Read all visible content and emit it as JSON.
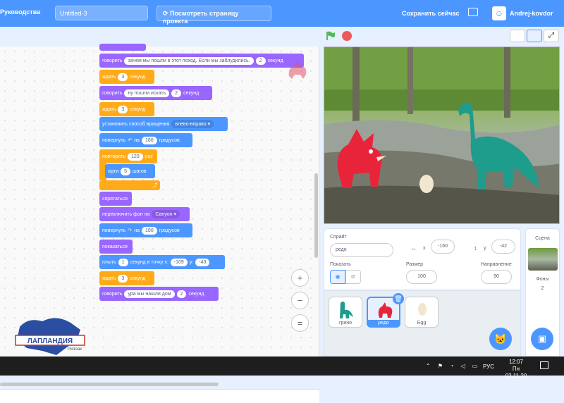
{
  "menubar": {
    "tutorials": "Руководства",
    "project_title": "Untitled-3",
    "see_project_page": "Посмотреть страницу проекта",
    "save_now": "Сохранить сейчас",
    "username": "Andrej-kovdor"
  },
  "script": {
    "b1": {
      "text": "говорить",
      "arg": "зачем мы пошли в этот поход. Если мы заблудились.",
      "num": "2",
      "tail": "секунд"
    },
    "b2": {
      "text": "ждать",
      "num": "3",
      "tail": "секунд"
    },
    "b3": {
      "text": "говорить",
      "arg": "ну пошли искать",
      "num": "2",
      "tail": "секунд"
    },
    "b4": {
      "text": "ждать",
      "num": "3",
      "tail": "секунд"
    },
    "b5": {
      "text": "установить способ вращения",
      "dropdown": "влево-вправо"
    },
    "b6": {
      "text": "повернуть",
      "on": "на",
      "num": "180",
      "tail": "градусов"
    },
    "b7": {
      "text": "повторить",
      "num": "120",
      "tail": "раз"
    },
    "b8": {
      "text": "идти",
      "num": "5",
      "tail": "шагов"
    },
    "b9": {
      "text": "спрятаться"
    },
    "b10": {
      "text": "переключить фон на",
      "dropdown": "Canyon"
    },
    "b11": {
      "text": "повернуть",
      "on": "на",
      "num": "180",
      "tail": "градусов"
    },
    "b12": {
      "text": "показаться"
    },
    "b13": {
      "text": "плыть",
      "num": "1",
      "mid": "секунд в точку x:",
      "x": "-109",
      "ylbl": "y:",
      "y": "-43"
    },
    "b14": {
      "text": "ждать",
      "num": "3",
      "tail": "секунд"
    },
    "b15": {
      "text": "говорить",
      "arg": "ура мы нашли дом",
      "num": "2",
      "tail": "секунд"
    }
  },
  "sprite": {
    "label": "Спрайт",
    "name": "редо",
    "x_label": "x",
    "x": "-160",
    "y_label": "y",
    "y": "-42",
    "show_label": "Показать",
    "size_label": "Размер",
    "size": "100",
    "direction_label": "Направление",
    "direction": "90"
  },
  "sprites": [
    {
      "name": "грино"
    },
    {
      "name": "редо"
    },
    {
      "name": "Egg"
    }
  ],
  "stage_pane": {
    "title": "Сцена",
    "backdrops_label": "Фоны",
    "backdrops_count": "2"
  },
  "taskbar": {
    "lang": "РУС",
    "time": "12:07",
    "date": "Пн 02.11.20"
  },
  "logo": {
    "text": "ЛАПЛАНДИЯ",
    "sub": "Рюкзак"
  },
  "colors": {
    "accent": "#4c97ff",
    "looks": "#9966ff",
    "control": "#ffab19",
    "motion": "#4c97ff"
  }
}
